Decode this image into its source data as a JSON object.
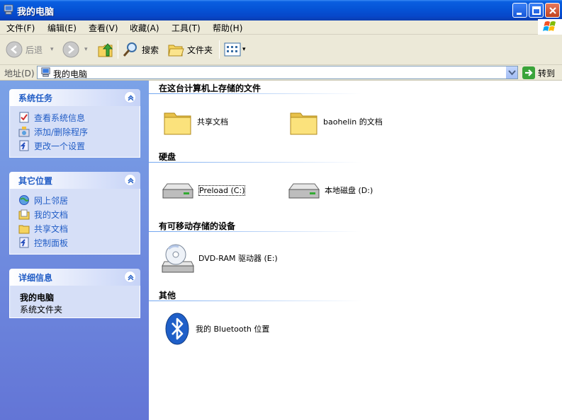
{
  "window": {
    "title": "我的电脑"
  },
  "menu": [
    {
      "label": "文件(F)"
    },
    {
      "label": "编辑(E)"
    },
    {
      "label": "查看(V)"
    },
    {
      "label": "收藏(A)"
    },
    {
      "label": "工具(T)"
    },
    {
      "label": "帮助(H)"
    }
  ],
  "toolbar": {
    "back": "后退",
    "search": "搜索",
    "folders": "文件夹"
  },
  "address": {
    "label": "地址(D)",
    "value": "我的电脑",
    "go": "转到"
  },
  "sidebar": {
    "tasks": {
      "title": "系统任务",
      "items": [
        {
          "label": "查看系统信息",
          "icon": "system-info-icon"
        },
        {
          "label": "添加/删除程序",
          "icon": "add-remove-programs-icon"
        },
        {
          "label": "更改一个设置",
          "icon": "control-panel-icon"
        }
      ]
    },
    "places": {
      "title": "其它位置",
      "items": [
        {
          "label": "网上邻居",
          "icon": "network-icon"
        },
        {
          "label": "我的文档",
          "icon": "my-documents-icon"
        },
        {
          "label": "共享文档",
          "icon": "folder-icon"
        },
        {
          "label": "控制面板",
          "icon": "control-panel-icon"
        }
      ]
    },
    "details": {
      "title": "详细信息",
      "name": "我的电脑",
      "type": "系统文件夹"
    }
  },
  "content": {
    "groups": [
      {
        "title": "在这台计算机上存储的文件",
        "items": [
          {
            "label": "共享文档"
          },
          {
            "label": "baohelin 的文档"
          }
        ]
      },
      {
        "title": "硬盘",
        "items": [
          {
            "label": "Preload (C:)"
          },
          {
            "label": "本地磁盘 (D:)"
          }
        ]
      },
      {
        "title": "有可移动存储的设备",
        "items": [
          {
            "label": "DVD-RAM 驱动器 (E:)"
          }
        ]
      },
      {
        "title": "其他",
        "items": [
          {
            "label": "我的 Bluetooth 位置"
          }
        ]
      }
    ]
  },
  "colors": {
    "title_bar": "#0553d6",
    "sidebar": "#7ba2e7",
    "link": "#215dc6",
    "chrome": "#ece9d8"
  }
}
